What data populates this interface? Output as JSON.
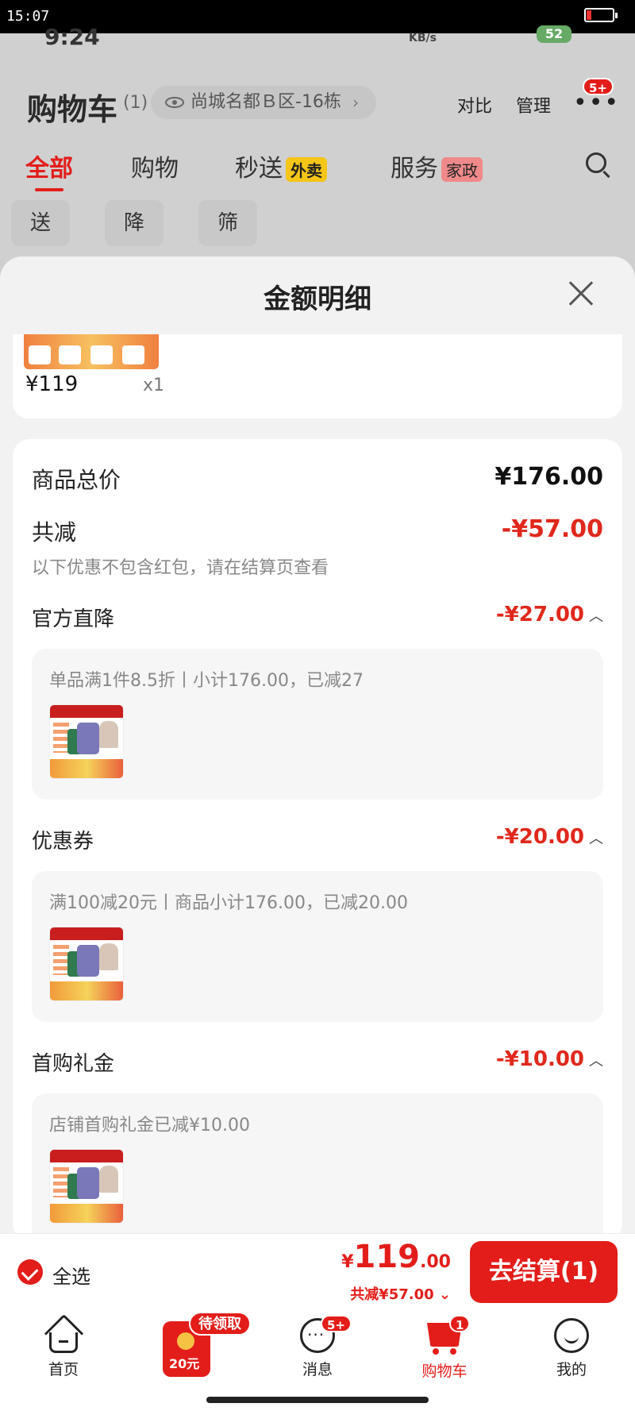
{
  "system": {
    "time": "15:07"
  },
  "background": {
    "phone_time": "9:24",
    "net_speed": "KB/s",
    "battery": "52",
    "title": "购物车",
    "count": "(1)",
    "address": "尚城名都Ｂ区-16栋",
    "actions": [
      "对比",
      "管理"
    ],
    "more_badge": "5+",
    "tabs": [
      {
        "label": "全部"
      },
      {
        "label": "购物"
      },
      {
        "label": "秒送",
        "tag": "外卖"
      },
      {
        "label": "服务",
        "tag": "家政"
      }
    ],
    "chips": [
      "送礼",
      "降价",
      "筛选 ▽"
    ]
  },
  "sheet": {
    "title": "金额明细",
    "product": {
      "price": "¥119",
      "qty": "x1"
    },
    "total_label": "商品总价",
    "total_value": "¥176.00",
    "reduce_label": "共减",
    "reduce_value": "-¥57.00",
    "reduce_note": "以下优惠不包含红包，请在结算页查看",
    "sections": [
      {
        "label": "官方直降",
        "value": "-¥27.00",
        "desc": "单品满1件8.5折丨小计176.00，已减27"
      },
      {
        "label": "优惠券",
        "value": "-¥20.00",
        "desc": "满100减20元丨商品小计176.00，已减20.00"
      },
      {
        "label": "首购礼金",
        "value": "-¥10.00",
        "desc": "店铺首购礼金已减¥10.00"
      }
    ]
  },
  "checkout": {
    "select_all": "全选",
    "currency": "¥",
    "total_int": "119",
    "total_dec": ".00",
    "saved": "共减¥57.00 ⌄",
    "pay_button": "去结算(1)"
  },
  "tabbar": {
    "items": [
      {
        "label": "首页"
      },
      {
        "label": "消息",
        "badge": "5+"
      },
      {
        "label": "购物车",
        "badge": "1"
      },
      {
        "label": "我的"
      }
    ],
    "gift_badge": "待领取",
    "gift_amount": "20元"
  },
  "colors": {
    "accent": "#e31d1a",
    "discount": "#e0281c"
  }
}
